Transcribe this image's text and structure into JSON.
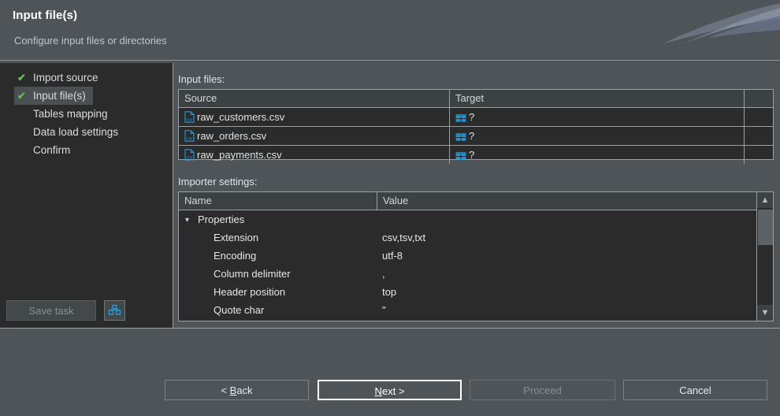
{
  "header": {
    "title": "Input file(s)",
    "subtitle": "Configure input files or directories"
  },
  "sidebar": {
    "items": [
      {
        "label": "Import source",
        "checked": true,
        "current": false
      },
      {
        "label": "Input file(s)",
        "checked": true,
        "current": true
      },
      {
        "label": "Tables mapping",
        "checked": false,
        "current": false
      },
      {
        "label": "Data load settings",
        "checked": false,
        "current": false
      },
      {
        "label": "Confirm",
        "checked": false,
        "current": false
      }
    ],
    "save_task_label": "Save task",
    "save_icon": "save-task-icon"
  },
  "main": {
    "input_files_label": "Input files:",
    "importer_settings_label": "Importer settings:",
    "files_table": {
      "columns": [
        "Source",
        "Target",
        ""
      ],
      "rows": [
        {
          "source": "raw_customers.csv",
          "target": "?",
          "source_icon": "csv-file-icon",
          "target_icon": "table-icon"
        },
        {
          "source": "raw_orders.csv",
          "target": "?",
          "source_icon": "csv-file-icon",
          "target_icon": "table-icon"
        },
        {
          "source": "raw_payments.csv",
          "target": "?",
          "source_icon": "csv-file-icon",
          "target_icon": "table-icon"
        }
      ]
    },
    "settings_table": {
      "columns": [
        "Name",
        "Value"
      ],
      "rows": [
        {
          "name": "Properties",
          "value": "",
          "group": true
        },
        {
          "name": "Extension",
          "value": "csv,tsv,txt",
          "group": false
        },
        {
          "name": "Encoding",
          "value": "utf-8",
          "group": false
        },
        {
          "name": "Column delimiter",
          "value": ",",
          "group": false
        },
        {
          "name": "Header position",
          "value": "top",
          "group": false
        },
        {
          "name": "Quote char",
          "value": "\"",
          "group": false
        }
      ]
    }
  },
  "footer": {
    "back_label": "< Back",
    "back_prefix": "< ",
    "back_mnemonic": "B",
    "back_rest": "ack",
    "next_mnemonic": "N",
    "next_rest": "ext >",
    "proceed_label": "Proceed",
    "cancel_label": "Cancel"
  },
  "colors": {
    "background": "#4e5457",
    "panel": "#2b2b2b",
    "header_row": "#3c4143",
    "border": "#9aa0a3",
    "accent_blue": "#1f9ae0",
    "check_green": "#6cbb5a",
    "focus": "#ffffff"
  }
}
